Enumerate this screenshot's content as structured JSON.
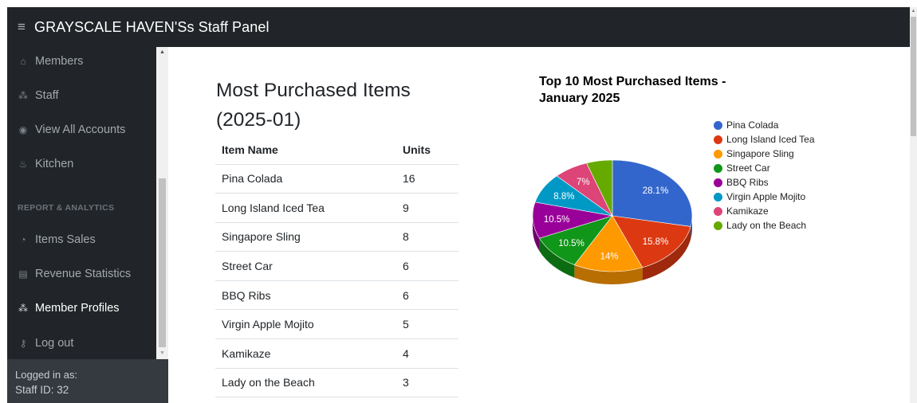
{
  "header": {
    "menu_icon": "hamburger-icon",
    "title": "GRAYSCALE HAVEN'Ss Staff Panel"
  },
  "sidebar": {
    "items": [
      {
        "label": "Members",
        "icon": "home-icon"
      },
      {
        "label": "Staff",
        "icon": "users-icon"
      },
      {
        "label": "View All Accounts",
        "icon": "eye-icon"
      },
      {
        "label": "Kitchen",
        "icon": "kitchen-icon"
      },
      {
        "label": "Items Sales",
        "icon": "clock-icon"
      },
      {
        "label": "Revenue Statistics",
        "icon": "chart-icon"
      },
      {
        "label": "Member Profiles",
        "icon": "users-icon"
      },
      {
        "label": "Log out",
        "icon": "key-icon"
      }
    ],
    "section_heading": "REPORT & ANALYTICS",
    "active_item": "Member Profiles",
    "footer": {
      "logged_in_label": "Logged in as:",
      "staff_id": "Staff ID: 32"
    }
  },
  "main": {
    "title": "Most Purchased Items (2025-01)",
    "table": {
      "columns": [
        "Item Name",
        "Units"
      ],
      "rows": [
        [
          "Pina Colada",
          "16"
        ],
        [
          "Long Island Iced Tea",
          "9"
        ],
        [
          "Singapore Sling",
          "8"
        ],
        [
          "Street Car",
          "6"
        ],
        [
          "BBQ Ribs",
          "6"
        ],
        [
          "Virgin Apple Mojito",
          "5"
        ],
        [
          "Kamikaze",
          "4"
        ],
        [
          "Lady on the Beach",
          "3"
        ]
      ]
    }
  },
  "chart_data": {
    "type": "pie",
    "title": "Top 10 Most Purchased Items - January 2025",
    "legend_position": "right",
    "categories": [
      "Pina Colada",
      "Long Island Iced Tea",
      "Singapore Sling",
      "Street Car",
      "BBQ Ribs",
      "Virgin Apple Mojito",
      "Kamikaze",
      "Lady on the Beach"
    ],
    "values": [
      16,
      9,
      8,
      6,
      6,
      5,
      4,
      3
    ],
    "percent_labels": [
      "28.1%",
      "15.8%",
      "14%",
      "10.5%",
      "10.5%",
      "8.8%",
      "7%",
      ""
    ],
    "colors": [
      "#3366cc",
      "#dc3912",
      "#ff9900",
      "#109618",
      "#990099",
      "#0099c6",
      "#dd4477",
      "#66aa00"
    ],
    "is3D": true
  }
}
